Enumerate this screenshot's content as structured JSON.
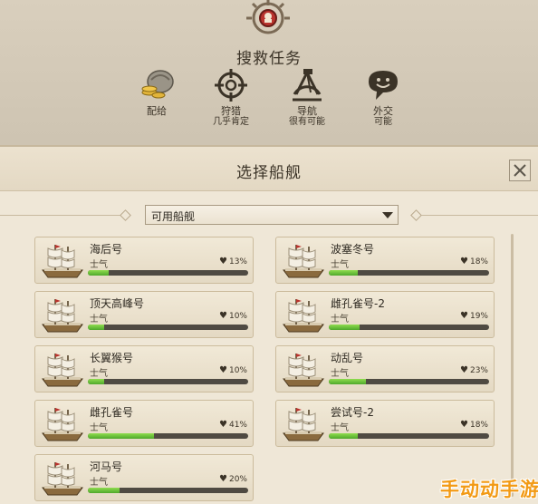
{
  "mission": {
    "title": "搜救任务",
    "tasks": [
      {
        "icon": "supply-icon",
        "label": "配给",
        "sub": ""
      },
      {
        "icon": "crosshair-icon",
        "label": "狩猎",
        "sub": "几乎肯定"
      },
      {
        "icon": "sextant-icon",
        "label": "导航",
        "sub": "很有可能"
      },
      {
        "icon": "speech-bubble-icon",
        "label": "外交",
        "sub": "可能"
      }
    ]
  },
  "panel": {
    "title": "选择船舰",
    "filter_selected": "可用船舰",
    "morale_label": "士气",
    "ships": [
      {
        "name": "海后号",
        "morale": "13%",
        "morale_value": 0.13
      },
      {
        "name": "波塞冬号",
        "morale": "18%",
        "morale_value": 0.18
      },
      {
        "name": "顶天高峰号",
        "morale": "10%",
        "morale_value": 0.1
      },
      {
        "name": "雌孔雀号-2",
        "morale": "19%",
        "morale_value": 0.19
      },
      {
        "name": "长翼猴号",
        "morale": "10%",
        "morale_value": 0.1
      },
      {
        "name": "动乱号",
        "morale": "23%",
        "morale_value": 0.23
      },
      {
        "name": "雌孔雀号",
        "morale": "41%",
        "morale_value": 0.41
      },
      {
        "name": "尝试号-2",
        "morale": "18%",
        "morale_value": 0.18
      },
      {
        "name": "河马号",
        "morale": "20%",
        "morale_value": 0.2
      }
    ]
  },
  "watermark": {
    "text": "手动动手游"
  },
  "colors": {
    "morale_fill": "#5fbf34",
    "panel_bg": "#efe7d7",
    "text": "#2f2a22"
  }
}
